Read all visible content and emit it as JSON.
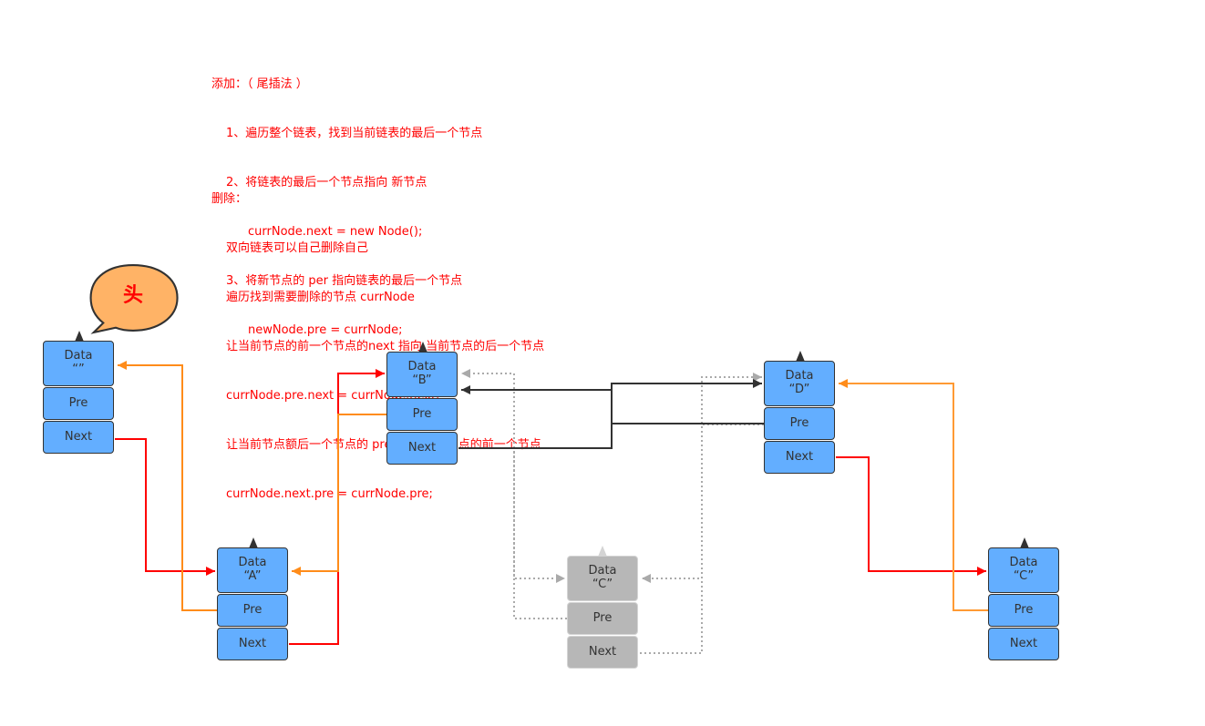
{
  "notes": {
    "add": {
      "title": "添加：（ 尾插法 ）",
      "lines": [
        {
          "indent": 1,
          "text": "1、遍历整个链表，找到当前链表的最后一个节点"
        },
        {
          "indent": 1,
          "text": "2、将链表的最后一个节点指向 新节点"
        },
        {
          "indent": 2,
          "text": "currNode.next = new Node();"
        },
        {
          "indent": 1,
          "text": "3、将新节点的 per 指向链表的最后一个节点"
        },
        {
          "indent": 2,
          "text": "newNode.pre = currNode;"
        }
      ]
    },
    "delete": {
      "title": "删除：",
      "lines": [
        {
          "indent": 1,
          "text": "双向链表可以自己删除自己"
        },
        {
          "indent": 1,
          "text": "遍历找到需要删除的节点 currNode"
        },
        {
          "indent": 1,
          "text": "让当前节点的前一个节点的next 指向 当前节点的后一个节点"
        },
        {
          "indent": 1,
          "text": "currNode.pre.next = currNode.next;"
        },
        {
          "indent": 1,
          "text": "让当前节点额后一个节点的 pre 指向 当前节点的前一个节点"
        },
        {
          "indent": 1,
          "text": "currNode.next.pre = currNode.pre;"
        }
      ]
    }
  },
  "head_bubble": {
    "label": "头",
    "fill": "#ffb366",
    "text_color": "#ff0000"
  },
  "colors": {
    "node_fill": "#63aeff",
    "node_border": "#323232",
    "ghost_fill": "#b7b7b7",
    "next_link": "#ff0000",
    "pre_link": "#ff8c1a",
    "bypass_link": "#323232",
    "ghost_link": "#aaaaaa"
  },
  "nodes": [
    {
      "id": "head",
      "data_label": "Data",
      "data_value": "“”",
      "pre_label": "Pre",
      "next_label": "Next",
      "state": "active"
    },
    {
      "id": "A",
      "data_label": "Data",
      "data_value": "“A”",
      "pre_label": "Pre",
      "next_label": "Next",
      "state": "active"
    },
    {
      "id": "B",
      "data_label": "Data",
      "data_value": "“B”",
      "pre_label": "Pre",
      "next_label": "Next",
      "state": "active"
    },
    {
      "id": "C-deleted",
      "data_label": "Data",
      "data_value": "“C”",
      "pre_label": "Pre",
      "next_label": "Next",
      "state": "deleted"
    },
    {
      "id": "D",
      "data_label": "Data",
      "data_value": "“D”",
      "pre_label": "Pre",
      "next_label": "Next",
      "state": "active"
    },
    {
      "id": "C",
      "data_label": "Data",
      "data_value": "“C”",
      "pre_label": "Pre",
      "next_label": "Next",
      "state": "active"
    }
  ],
  "links": [
    {
      "from": "head.next",
      "to": "A.data",
      "kind": "next"
    },
    {
      "from": "A.pre",
      "to": "head.data",
      "kind": "pre"
    },
    {
      "from": "A.next",
      "to": "B.data",
      "kind": "next"
    },
    {
      "from": "B.pre",
      "to": "A.data",
      "kind": "pre"
    },
    {
      "from": "B.next",
      "to": "D.data",
      "kind": "bypass"
    },
    {
      "from": "D.pre",
      "to": "B.data",
      "kind": "bypass"
    },
    {
      "from": "B.next",
      "to": "C-deleted.data",
      "kind": "ghost"
    },
    {
      "from": "C-deleted.pre",
      "to": "B.data",
      "kind": "ghost"
    },
    {
      "from": "C-deleted.next",
      "to": "D.data",
      "kind": "ghost"
    },
    {
      "from": "D.pre",
      "to": "C-deleted.data",
      "kind": "ghost"
    },
    {
      "from": "D.next",
      "to": "C.data",
      "kind": "next"
    },
    {
      "from": "C.pre",
      "to": "D.data",
      "kind": "pre"
    }
  ]
}
